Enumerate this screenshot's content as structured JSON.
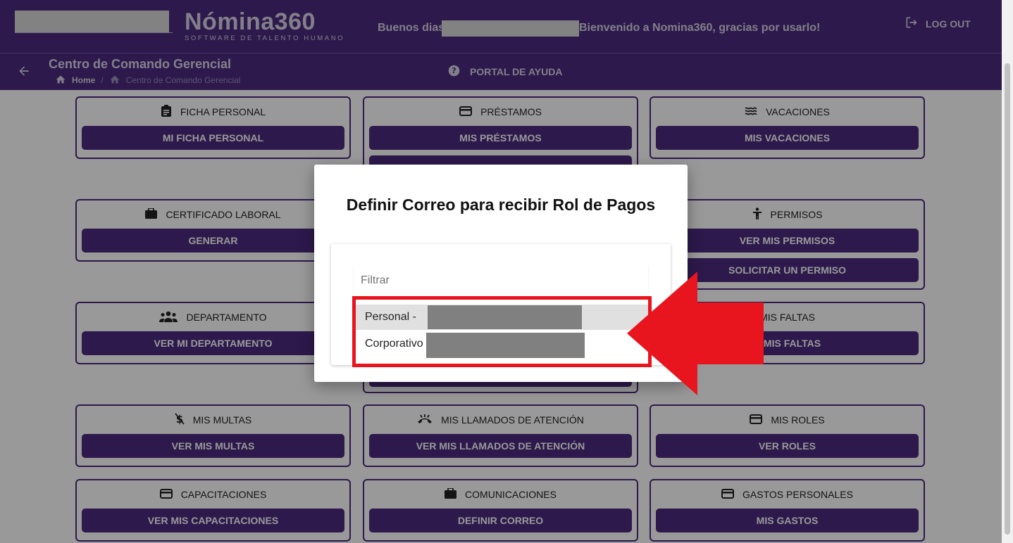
{
  "header": {
    "brand": "Nómina360",
    "tagline": "SOFTWARE DE TALENTO HUMANO",
    "greeting_prefix": "Buenos dias",
    "greeting_suffix": "Bienvenido a Nomina360, gracias por usarlo!",
    "logout_label": "LOG OUT"
  },
  "subheader": {
    "title": "Centro de Comando Gerencial",
    "breadcrumb": [
      "Home",
      "/",
      "Centro de Comando Gerencial"
    ],
    "help_label": "PORTAL DE AYUDA"
  },
  "cards": [
    {
      "title": "FICHA PERSONAL",
      "icon": "badge-icon",
      "buttons": [
        "MI FICHA PERSONAL"
      ]
    },
    {
      "title": "PRÉSTAMOS",
      "icon": "credit-card-icon",
      "buttons": [
        "MIS PRÉSTAMOS"
      ]
    },
    {
      "title": "VACACIONES",
      "icon": "waves-icon",
      "buttons": [
        "MIS VACACIONES"
      ]
    },
    {
      "title": "CERTIFICADO LABORAL",
      "icon": "briefcase-icon",
      "buttons": [
        "GENERAR"
      ]
    },
    {
      "title": "PERMISOS",
      "icon": "person-icon",
      "buttons": [
        "VER MIS PERMISOS",
        "SOLICITAR UN PERMISO"
      ]
    },
    {
      "title": "DEPARTAMENTO",
      "icon": "group-icon",
      "buttons": [
        "VER MI DEPARTAMENTO"
      ]
    },
    {
      "title": "MIS FALTAS",
      "icon": "",
      "buttons": [
        "R MIS FALTAS"
      ]
    },
    {
      "title": "MIS MULTAS",
      "icon": "money-off-icon",
      "buttons": [
        "VER MIS MULTAS"
      ]
    },
    {
      "title": "MIS LLAMADOS DE ATENCIÓN",
      "icon": "phone-callback-icon",
      "buttons": [
        "VER MIS LLAMADOS DE ATENCIÓN"
      ]
    },
    {
      "title": "MIS ROLES",
      "icon": "credit-card-icon",
      "buttons": [
        "VER ROLES"
      ]
    },
    {
      "title": "CAPACITACIONES",
      "icon": "credit-card-icon",
      "buttons": [
        "VER MIS CAPACITACIONES"
      ]
    },
    {
      "title": "COMUNICACIONES",
      "icon": "briefcase-icon",
      "buttons": [
        "DEFINIR CORREO"
      ]
    },
    {
      "title": "GASTOS PERSONALES",
      "icon": "credit-card-icon",
      "buttons": [
        "MIS GASTOS"
      ]
    }
  ],
  "dialog": {
    "title": "Definir Correo para recibir Rol de Pagos",
    "filter_placeholder": "Filtrar",
    "options": [
      {
        "label": "Personal -",
        "selected": true
      },
      {
        "label": "Corporativo",
        "selected": false
      }
    ]
  },
  "colors": {
    "primary": "#4b2a7f",
    "highlight": "#e8141e",
    "redaction": "#808080"
  }
}
